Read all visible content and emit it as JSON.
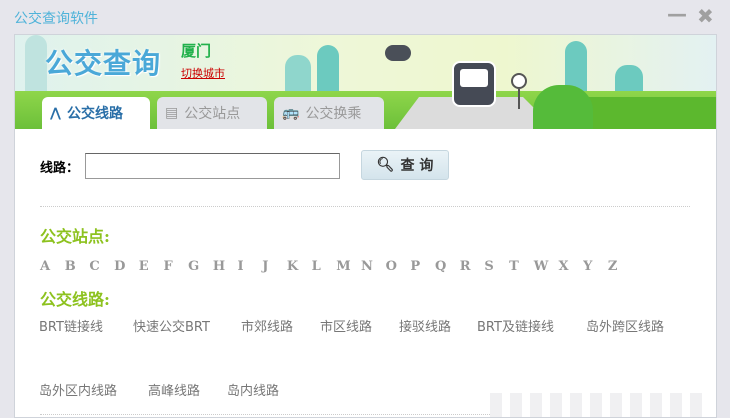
{
  "window": {
    "title": "公交查询软件",
    "minimize": "—",
    "close": "✖"
  },
  "banner": {
    "logo": "公交查询",
    "city": "厦门",
    "switch_city": "切换城市"
  },
  "tabs": [
    {
      "label": "公交线路"
    },
    {
      "label": "公交站点"
    },
    {
      "label": "公交换乘"
    }
  ],
  "search": {
    "label": "线路：",
    "value": "",
    "button": "查 询"
  },
  "stations": {
    "heading": "公交站点:",
    "letters": [
      "A",
      "B",
      "C",
      "D",
      "E",
      "F",
      "G",
      "H",
      "I",
      "J",
      "K",
      "L",
      "M",
      "N",
      "O",
      "P",
      "Q",
      "R",
      "S",
      "T",
      "W",
      "X",
      "Y",
      "Z"
    ]
  },
  "routes": {
    "heading": "公交线路:",
    "items": [
      "BRT链接线",
      "快速公交BRT",
      "市郊线路",
      "市区线路",
      "接驳线路",
      "BRT及链接线",
      "岛外跨区线路",
      "岛外区内线路",
      "高峰线路",
      "岛内线路"
    ]
  }
}
